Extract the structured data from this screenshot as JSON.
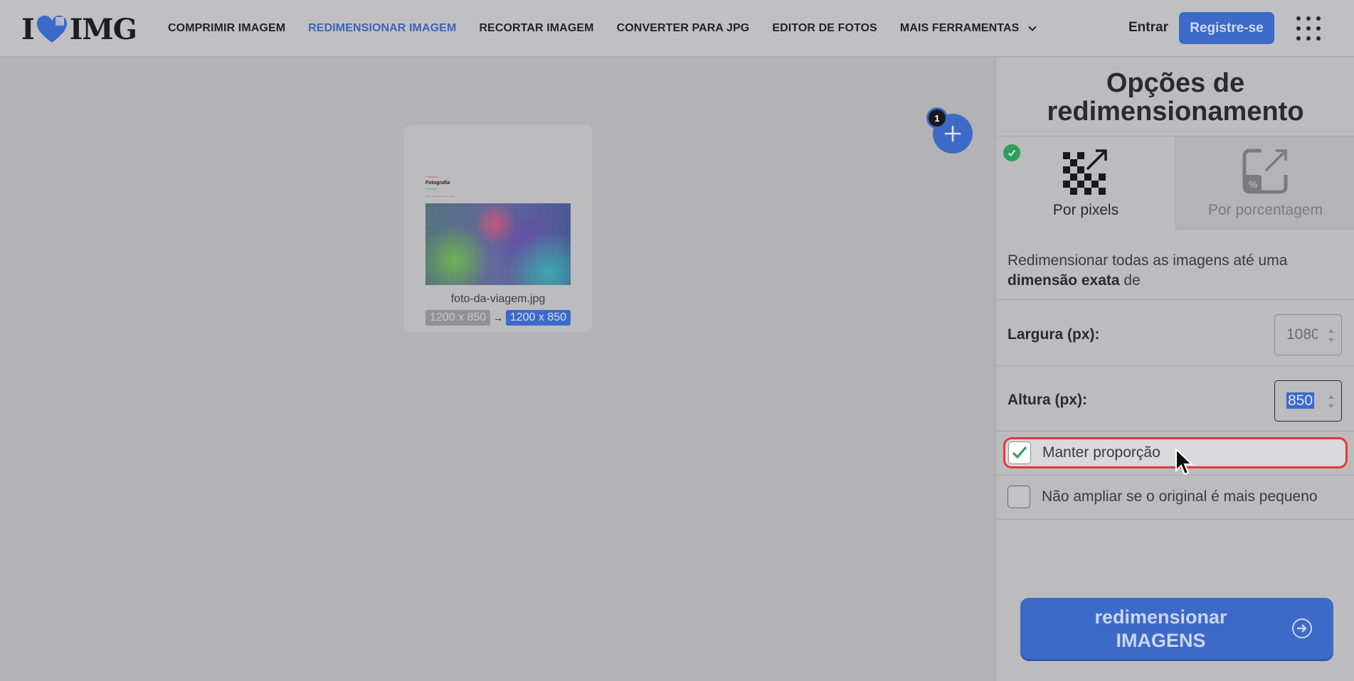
{
  "brand": {
    "logo_left": "I",
    "logo_right": "IMG",
    "accent": "#3d6ac8"
  },
  "nav": {
    "items": [
      {
        "label": "COMPRIMIR IMAGEM",
        "active": false
      },
      {
        "label": "REDIMENSIONAR IMAGEM",
        "active": true
      },
      {
        "label": "RECORTAR IMAGEM",
        "active": false
      },
      {
        "label": "CONVERTER PARA JPG",
        "active": false
      },
      {
        "label": "EDITOR DE FOTOS",
        "active": false
      },
      {
        "label": "MAIS FERRAMENTAS",
        "active": false,
        "icon": "chevron-down-icon"
      }
    ],
    "login": "Entrar",
    "register": "Registre-se",
    "apps_icon": "grid-menu-icon"
  },
  "file_card": {
    "mini_category": "Categoria",
    "mini_title": "Fotografia",
    "mini_subtitle": "Por autor",
    "mini_body": "Texto do documento de viagem",
    "filename": "foto-da-viagem.jpg",
    "dim_original": "1200 x 850",
    "dim_arrow": "→",
    "dim_new": "1200 x 850"
  },
  "add_button": {
    "icon": "plus-icon",
    "count": "1"
  },
  "panel": {
    "title_line1": "Opções de",
    "title_line2": "redimensionamento",
    "tabs": [
      {
        "label": "Por pixels",
        "icon": "pixels-resize-icon",
        "selected": true
      },
      {
        "label": "Por porcentagem",
        "icon": "percentage-resize-icon",
        "selected": false
      }
    ],
    "desc_pre": "Redimensionar todas as imagens até uma",
    "desc_bold": "dimensão exata",
    "desc_post": "de",
    "width_label": "Largura (px):",
    "width_value": "1080",
    "height_label": "Altura (px):",
    "height_value": "850",
    "keep_ratio_label": "Manter proporção",
    "keep_ratio_checked": true,
    "no_enlarge_label": "Não ampliar se o original é mais pequeno",
    "no_enlarge_checked": false,
    "submit_line1": "redimensionar",
    "submit_line2": "IMAGENS"
  }
}
